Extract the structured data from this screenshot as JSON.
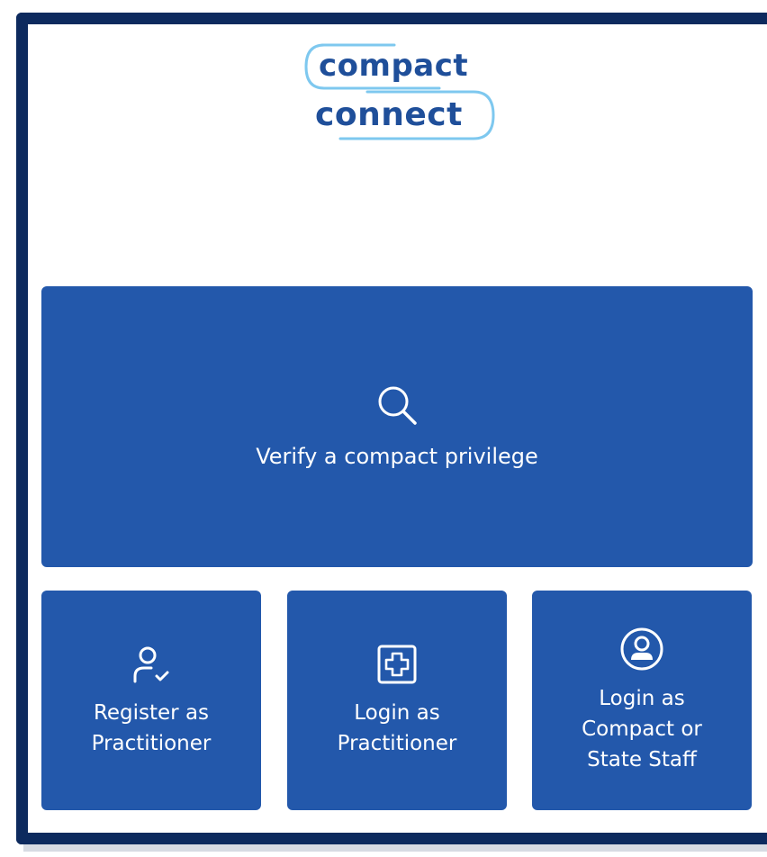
{
  "logo": {
    "line1": "compact",
    "line2": "connect"
  },
  "tiles": {
    "verify": {
      "label": "Verify a compact privilege",
      "icon": "search-icon"
    },
    "register": {
      "label": "Register as\nPractitioner",
      "icon": "user-check-icon"
    },
    "login_practitioner": {
      "label": "Login as\nPractitioner",
      "icon": "medical-plus-icon"
    },
    "login_staff": {
      "label": "Login as\nCompact or\nState Staff",
      "icon": "user-circle-icon"
    }
  },
  "colors": {
    "tile": "#2358ab",
    "frame": "#0d2a5e",
    "brand_text": "#1f4f9a",
    "brand_accent": "#7ec8ef"
  }
}
